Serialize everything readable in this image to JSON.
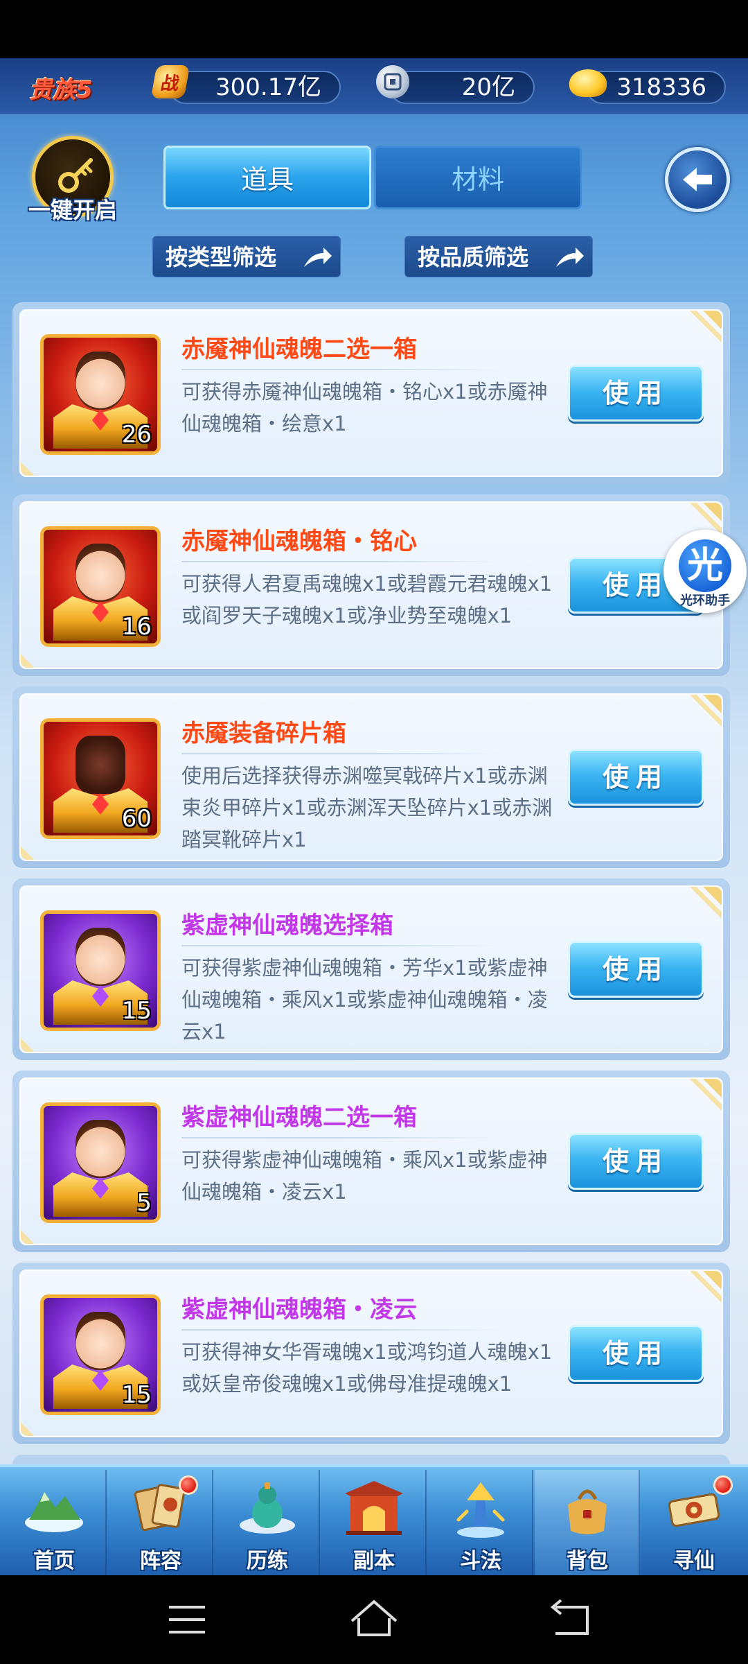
{
  "header": {
    "vip_label": "贵族5",
    "power_icon_text": "战",
    "power_value": "300.17亿",
    "coin_value": "20亿",
    "ingot_value": "318336"
  },
  "controls": {
    "one_key_open_label": "一键开启",
    "tabs": [
      {
        "label": "道具",
        "active": true
      },
      {
        "label": "材料",
        "active": false
      }
    ],
    "filter_type_label": "按类型筛选",
    "filter_quality_label": "按品质筛选"
  },
  "items": [
    {
      "name": "赤魇神仙魂魄二选一箱",
      "desc": "可获得赤魇神仙魂魄箱・铭心x1或赤魇神仙魂魄箱・绘意x1",
      "count": "26",
      "quality": "red",
      "button": "使用"
    },
    {
      "name": "赤魇神仙魂魄箱・铭心",
      "desc": "可获得人君夏禹魂魄x1或碧霞元君魂魄x1或阎罗天子魂魄x1或净业势至魂魄x1",
      "count": "16",
      "quality": "red",
      "button": "使用"
    },
    {
      "name": "赤魇装备碎片箱",
      "desc": "使用后选择获得赤渊噬冥戟碎片x1或赤渊束炎甲碎片x1或赤渊浑天坠碎片x1或赤渊踏冥靴碎片x1",
      "count": "60",
      "quality": "red",
      "button": "使用"
    },
    {
      "name": "紫虚神仙魂魄选择箱",
      "desc": "可获得紫虚神仙魂魄箱・芳华x1或紫虚神仙魂魄箱・乘风x1或紫虚神仙魂魄箱・凌云x1",
      "count": "15",
      "quality": "purple",
      "button": "使用"
    },
    {
      "name": "紫虚神仙魂魄二选一箱",
      "desc": "可获得紫虚神仙魂魄箱・乘风x1或紫虚神仙魂魄箱・凌云x1",
      "count": "5",
      "quality": "purple",
      "button": "使用"
    },
    {
      "name": "紫虚神仙魂魄箱・凌云",
      "desc": "可获得神女华胥魂魄x1或鸿钧道人魂魄x1或妖皇帝俊魂魄x1或佛母准提魂魄x1",
      "count": "15",
      "quality": "purple",
      "button": "使用"
    }
  ],
  "assistant": {
    "glyph": "光",
    "label": "光环助手"
  },
  "bottom_nav": [
    {
      "label": "首页",
      "icon": "home-island-icon",
      "badge": false,
      "active": false
    },
    {
      "label": "阵容",
      "icon": "lineup-cards-icon",
      "badge": true,
      "active": false
    },
    {
      "label": "历练",
      "icon": "training-gourd-icon",
      "badge": false,
      "active": false
    },
    {
      "label": "副本",
      "icon": "dungeon-gate-icon",
      "badge": false,
      "active": false
    },
    {
      "label": "斗法",
      "icon": "arena-tower-icon",
      "badge": false,
      "active": false
    },
    {
      "label": "背包",
      "icon": "backpack-bag-icon",
      "badge": false,
      "active": true
    },
    {
      "label": "寻仙",
      "icon": "seek-immortal-scroll-icon",
      "badge": true,
      "active": false
    }
  ],
  "colors": {
    "quality_red": "#ff4a16",
    "quality_purple": "#c238e8",
    "button_blue": "#3cb5f2",
    "notify_red": "#e01b12"
  }
}
